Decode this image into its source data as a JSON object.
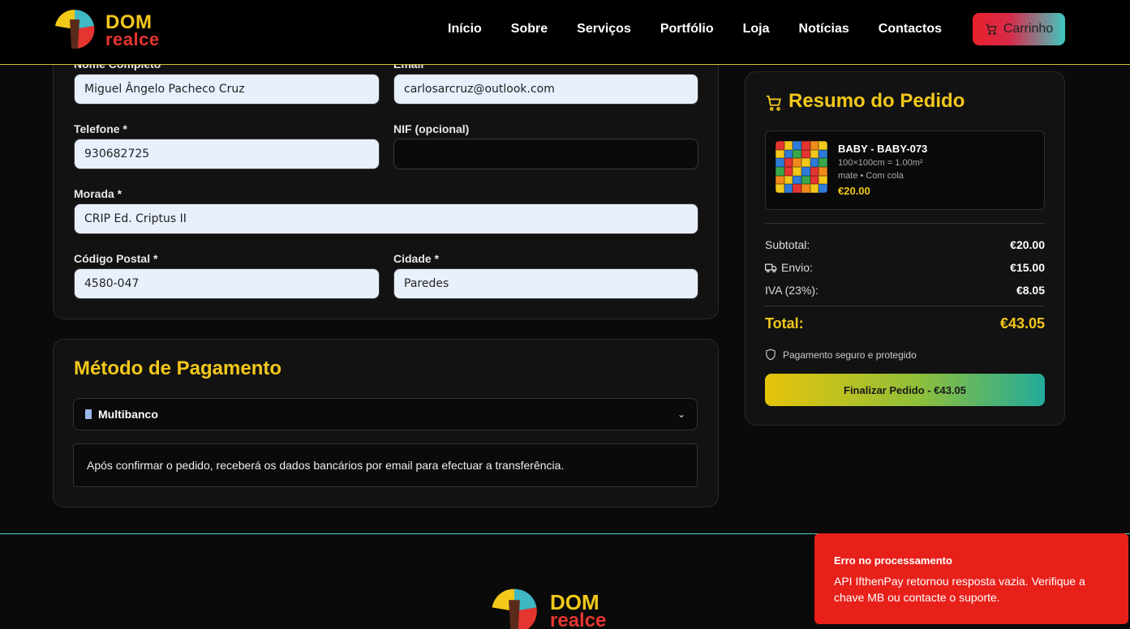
{
  "brand": {
    "name_top": "DOM",
    "name_bottom": "realce"
  },
  "nav": {
    "items": [
      "Início",
      "Sobre",
      "Serviços",
      "Portfólio",
      "Loja",
      "Notícias",
      "Contactos"
    ],
    "cart_label": "Carrinho"
  },
  "form": {
    "full_name_label": "Nome Completo",
    "full_name_value": "Miguel Ângelo Pacheco Cruz",
    "email_label": "Email",
    "email_value": "carlosarcruz@outlook.com",
    "phone_label": "Telefone *",
    "phone_value": "930682725",
    "nif_label": "NIF (opcional)",
    "nif_value": "",
    "address_label": "Morada *",
    "address_value": "CRIP Ed. Criptus II",
    "postal_label": "Código Postal *",
    "postal_value": "4580-047",
    "city_label": "Cidade *",
    "city_value": "Paredes"
  },
  "payment": {
    "title": "Método de Pagamento",
    "selected": "Multibanco",
    "info": "Após confirmar o pedido, receberá os dados bancários por email para efectuar a transferência."
  },
  "summary": {
    "title": "Resumo do Pedido",
    "product": {
      "name": "BABY - BABY-073",
      "size": "100×100cm = 1.00m²",
      "options": "mate • Com cola",
      "price": "€20.00"
    },
    "subtotal_label": "Subtotal:",
    "subtotal_value": "€20.00",
    "shipping_label": "Envio:",
    "shipping_value": "€15.00",
    "vat_label": "IVA (23%):",
    "vat_value": "€8.05",
    "total_label": "Total:",
    "total_value": "€43.05",
    "secure_text": "Pagamento seguro e protegido",
    "finalize_label": "Finalizar Pedido - €43.05"
  },
  "toast": {
    "title": "Erro no processamento",
    "message": "API IfthenPay retornou resposta vazia. Verifique a chave MB ou contacte o suporte."
  },
  "colors": {
    "accent": "#f2c81a",
    "error": "#e8201a",
    "teal": "#4fd1c8"
  }
}
